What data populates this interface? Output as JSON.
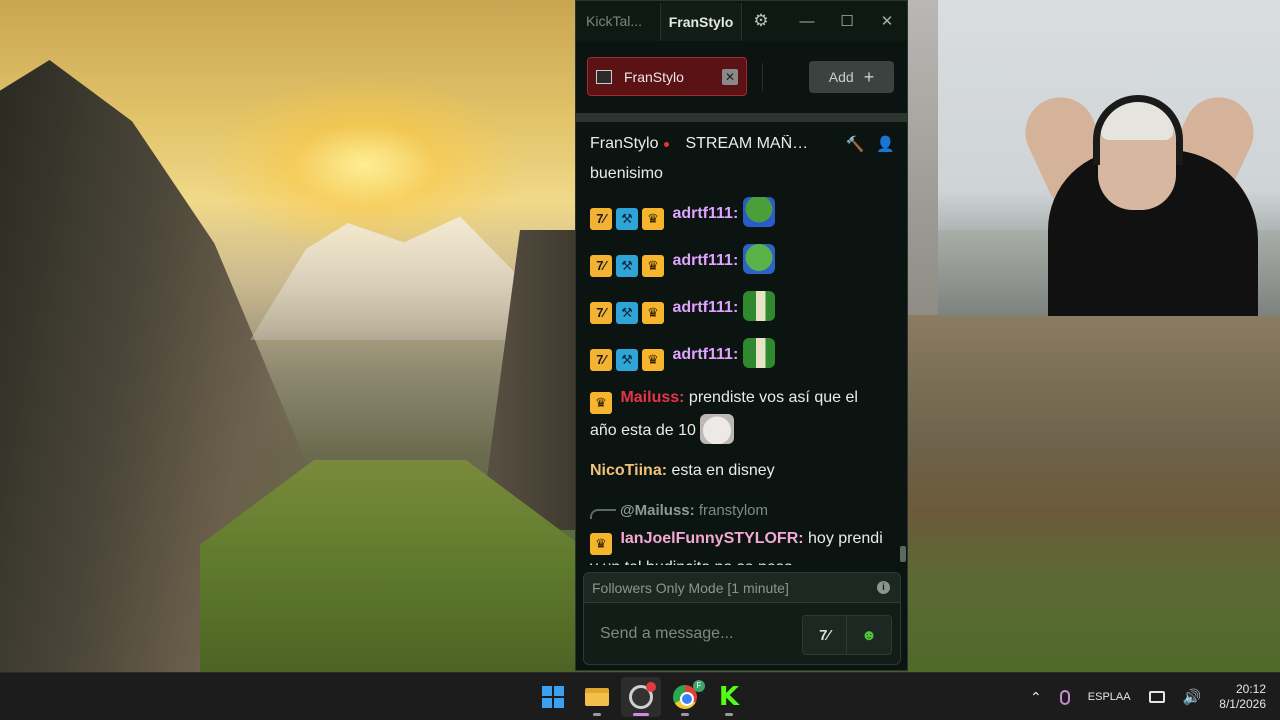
{
  "window": {
    "app_title": "KickTal...",
    "active_tab": "FranStylo",
    "minimize_glyph": "—",
    "maximize_glyph": "☐",
    "close_glyph": "✕"
  },
  "channels": {
    "chip_name": "FranStylo",
    "add_label": "Add"
  },
  "stream": {
    "channel": "FranStylo",
    "title": "STREAM MAÑANERO"
  },
  "messages": [
    {
      "id": "m0",
      "text": "buenisimo"
    },
    {
      "id": "m1",
      "user": "adrtf111:",
      "user_color": "#e0a3ff"
    },
    {
      "id": "m2",
      "user": "adrtf111:",
      "user_color": "#e0a3ff"
    },
    {
      "id": "m3",
      "user": "adrtf111:",
      "user_color": "#e0a3ff"
    },
    {
      "id": "m4",
      "user": "adrtf111:",
      "user_color": "#e0a3ff"
    },
    {
      "id": "m5",
      "user": "Mailuss:",
      "user_color": "#e8334a",
      "text": " prendiste vos así que el año esta de 10"
    },
    {
      "id": "m6",
      "user": "NicoTiina:",
      "user_color": "#f0c27a",
      "text": " esta en disney"
    },
    {
      "id": "m7",
      "reply_to": "@Mailuss:",
      "reply_text": " franstylom",
      "user": "IanJoelFunnySTYLOFR:",
      "user_color": "#f3a9d4",
      "text": " hoy prendi y un tal budincito no se paso"
    }
  ],
  "composer": {
    "mode_text": "Followers Only Mode [1 minute]",
    "placeholder": "Send a message...",
    "kick_button_label": "7⁄"
  },
  "taskbar": {
    "apps": [
      "start",
      "file-explorer",
      "obs-studio",
      "chrome",
      "kick"
    ],
    "chrome_badge": "F",
    "lang_top": "ESP",
    "lang_bottom": "LAA",
    "time": "20:12",
    "date": "8/1/2026"
  },
  "colors": {
    "chat_bg": "#0b1410",
    "channel_chip": "#5a1215",
    "kick_green": "#53fc18",
    "live_dot": "#e53434"
  }
}
